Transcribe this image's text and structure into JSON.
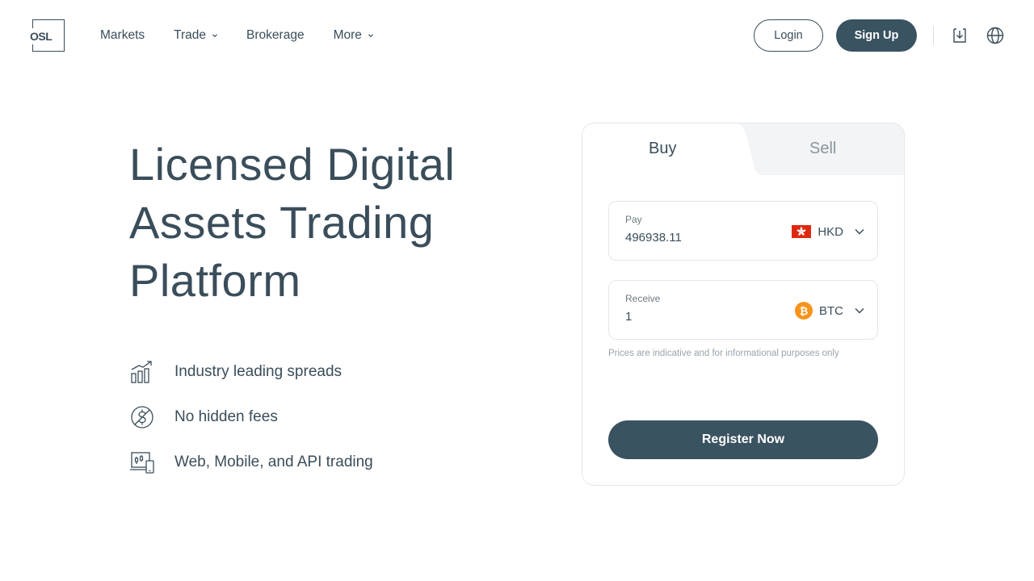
{
  "brand": {
    "logo_text": "OSL"
  },
  "nav": {
    "items": [
      {
        "label": "Markets",
        "has_dropdown": false
      },
      {
        "label": "Trade",
        "has_dropdown": true
      },
      {
        "label": "Brokerage",
        "has_dropdown": false
      },
      {
        "label": "More",
        "has_dropdown": true
      }
    ],
    "login_label": "Login",
    "signup_label": "Sign Up",
    "icons": [
      "download-icon",
      "globe-icon"
    ]
  },
  "hero": {
    "title": "Licensed Digital Assets Trading Platform",
    "features": [
      {
        "icon": "chart-growth-icon",
        "label": "Industry leading spreads"
      },
      {
        "icon": "no-fees-icon",
        "label": "No hidden fees"
      },
      {
        "icon": "devices-icon",
        "label": "Web, Mobile, and API trading"
      }
    ]
  },
  "trade_card": {
    "tabs": [
      {
        "label": "Buy",
        "active": true
      },
      {
        "label": "Sell",
        "active": false
      }
    ],
    "pay": {
      "label": "Pay",
      "value": "496938.11",
      "currency": "HKD",
      "currency_icon": "hk-flag-icon"
    },
    "receive": {
      "label": "Receive",
      "value": "1",
      "currency": "BTC",
      "currency_icon": "btc-icon"
    },
    "disclaimer": "Prices are indicative and for informational purposes only",
    "cta_label": "Register Now"
  },
  "colors": {
    "primary": "#3a5361",
    "text": "#3a4d5a",
    "muted": "#9aa3aa",
    "tab_inactive_bg": "#f2f4f6",
    "hk_flag": "#de2910",
    "btc": "#f7931a"
  }
}
